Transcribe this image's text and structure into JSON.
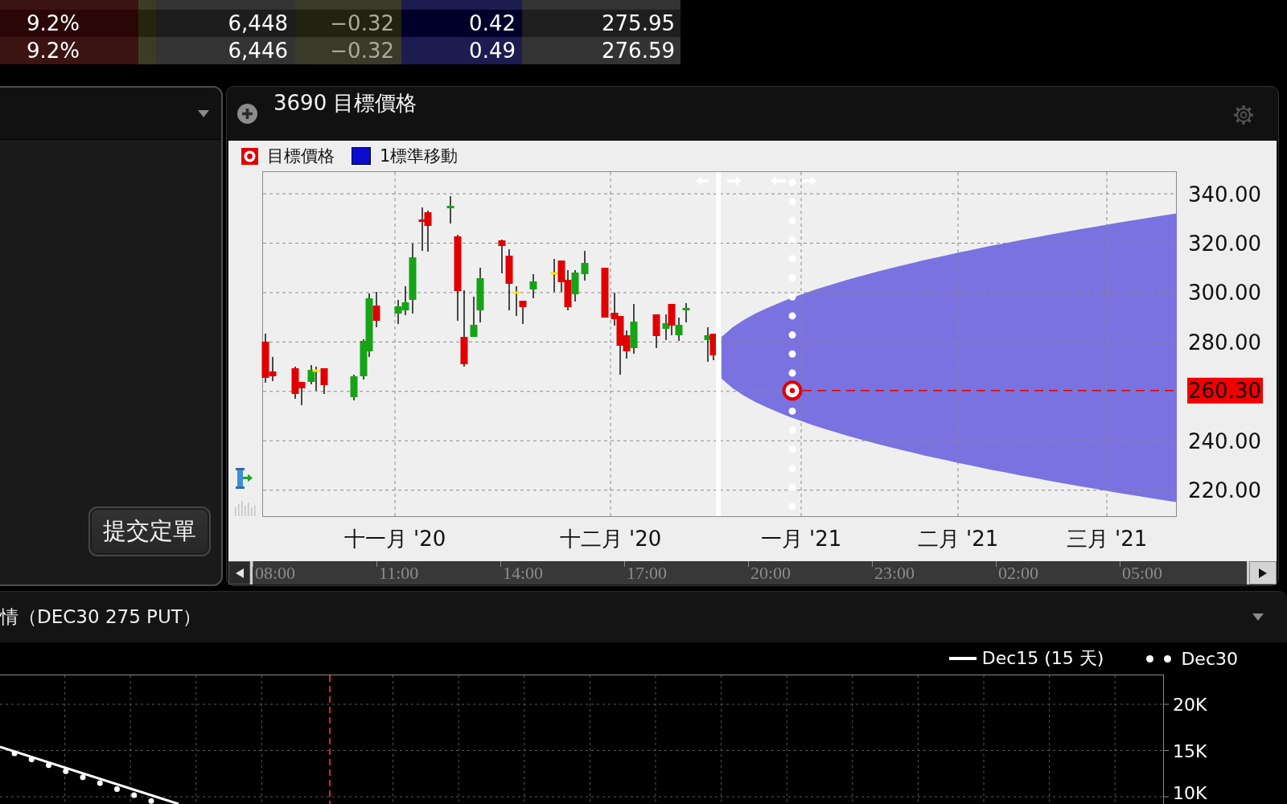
{
  "quote_table": {
    "rows": [
      {
        "cells": [
          "9.2%",
          "6,448",
          "−0.32",
          "0.42",
          "275.95"
        ]
      },
      {
        "cells": [
          "9.2%",
          "6,446",
          "−0.32",
          "0.49",
          "276.59"
        ]
      }
    ]
  },
  "order_panel": {
    "submit_button": "提交定單"
  },
  "chart_panel": {
    "title": "3690 目標價格",
    "legend": [
      {
        "kind": "target",
        "label": "目標價格"
      },
      {
        "kind": "band",
        "label": "1標準移動"
      }
    ],
    "y_axis_labels": [
      {
        "kind": "tick",
        "text": "340.00"
      },
      {
        "kind": "tick",
        "text": "320.00"
      },
      {
        "kind": "tick",
        "text": "300.00"
      },
      {
        "kind": "tick",
        "text": "280.00"
      },
      {
        "kind": "target",
        "text": "260.30"
      },
      {
        "kind": "tick",
        "text": "240.00"
      },
      {
        "kind": "tick",
        "text": "220.00"
      }
    ],
    "x_axis_labels": [
      "十一月 '20",
      "十二月 '20",
      "一月 '21",
      "二月 '21",
      "三月 '21"
    ],
    "time_scroller": {
      "labels": [
        "08:00",
        "11:00",
        "14:00",
        "17:00",
        "20:00",
        "23:00",
        "02:00",
        "05:00"
      ]
    }
  },
  "position_panel": {
    "title": "情（DEC30 275 PUT）",
    "legend": [
      {
        "kind": "solid",
        "label": "Dec15 (15 天)"
      },
      {
        "kind": "dotted",
        "label": "Dec30"
      }
    ],
    "y_axis_labels": [
      "20K",
      "15K",
      "10K"
    ]
  }
}
